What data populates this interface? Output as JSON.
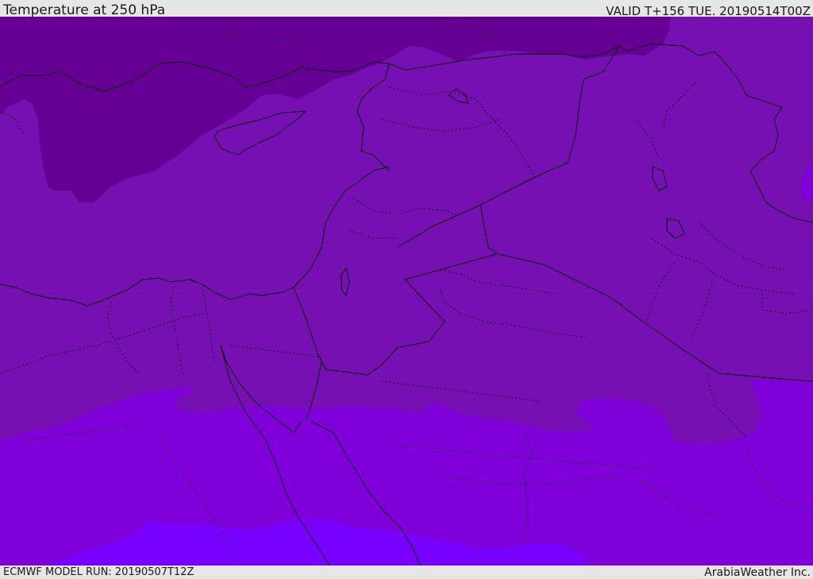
{
  "header": {
    "title": "Temperature at 250 hPa",
    "valid": "VALID T+156 TUE. 20190514T00Z"
  },
  "footer": {
    "model_run": "ECMWF MODEL RUN: 20190507T12Z",
    "brand": "ArabiaWeather Inc."
  },
  "map": {
    "colors": {
      "band_coldest": "#660095",
      "band_cold": "#7610b2",
      "band_mid": "#7f00d9",
      "band_warm": "#7800ff",
      "borders": "#000000"
    }
  }
}
